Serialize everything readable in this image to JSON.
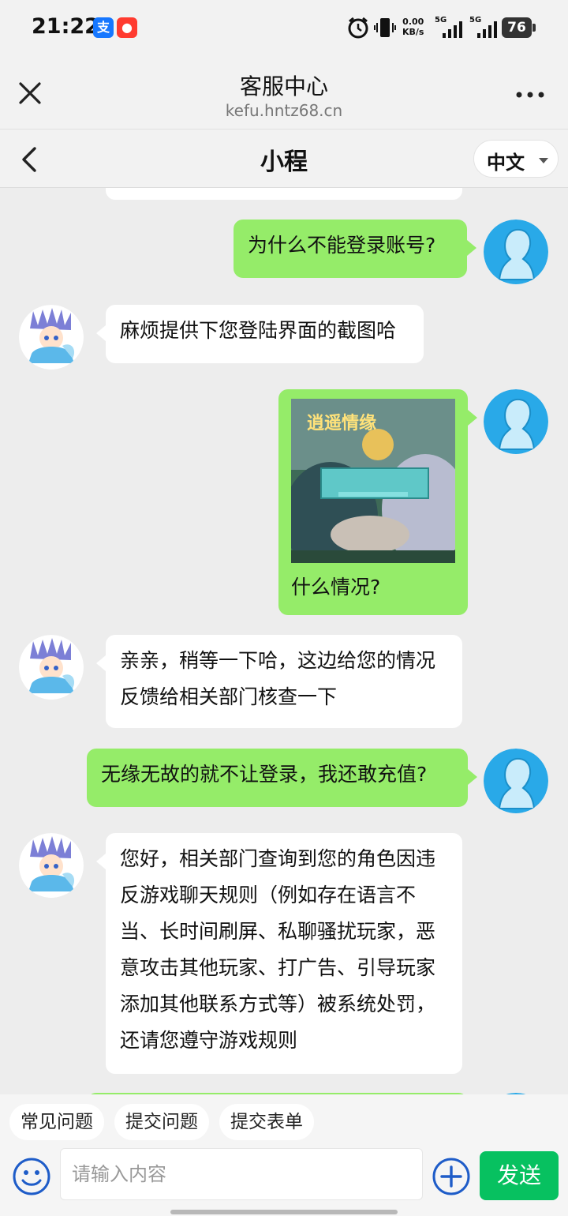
{
  "status_bar": {
    "time": "21:22",
    "app_icons": [
      "alipay-icon",
      "app-notification-icon"
    ],
    "net_speed_value": "0.00",
    "net_speed_unit": "KB/s",
    "signal1": "5G",
    "signal2": "5G",
    "battery": "76"
  },
  "browser": {
    "title": "客服中心",
    "url": "kefu.hntz68.cn"
  },
  "chat_header": {
    "title": "小程",
    "language": "中文"
  },
  "messages": [
    {
      "from": "agent",
      "text": "",
      "partial": true
    },
    {
      "from": "user",
      "text": "为什么不能登录账号?"
    },
    {
      "from": "agent",
      "text": "麻烦提供下您登陆界面的截图哈"
    },
    {
      "from": "user",
      "text": "什么情况?",
      "has_image": true,
      "image_game_title": "逍遥情缘"
    },
    {
      "from": "agent",
      "text": "亲亲，稍等一下哈，这边给您的情况反馈给相关部门核查一下"
    },
    {
      "from": "user",
      "text": "无缘无故的就不让登录，我还敢充值?"
    },
    {
      "from": "agent",
      "text": "您好，相关部门查询到您的角色因违反游戏聊天规则（例如存在语言不当、长时间刷屏、私聊骚扰玩家，恶意攻击其他玩家、打广告、引导玩家添加其他联系方式等）被系统处罚，还请您遵守游戏规则"
    }
  ],
  "quick_actions": [
    "常见问题",
    "提交问题",
    "提交表单"
  ],
  "input": {
    "placeholder": "请输入内容",
    "value": ""
  },
  "send_label": "发送",
  "colors": {
    "user_bubble": "#95ec69",
    "agent_bubble": "#ffffff",
    "send_button": "#07c160",
    "background": "#ededed"
  }
}
